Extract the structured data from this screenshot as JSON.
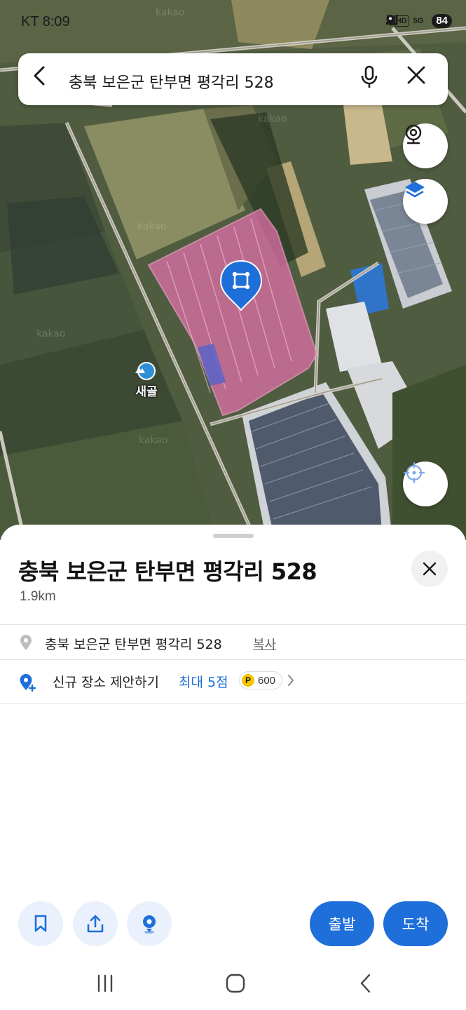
{
  "status_bar": {
    "carrier_time": "KT 8:09",
    "hd": "HD",
    "network": "5G",
    "battery": "84"
  },
  "search": {
    "query": "충북 보은군 탄부면 평각리 528",
    "back_icon": "chevron-left-icon",
    "mic_icon": "microphone-icon",
    "close_icon": "close-icon"
  },
  "map": {
    "watermark": "kakao",
    "place_label": "새골",
    "parcel_color": "#e070a8",
    "pin_color": "#1e6fd9",
    "buttons": [
      "roadview-icon",
      "layers-icon",
      "current-location-icon"
    ]
  },
  "sheet": {
    "title": "충북 보은군 탄부면 평각리 528",
    "distance": "1.9km",
    "address": "충북 보은군 탄부면 평각리 528",
    "copy_label": "복사",
    "suggest_label": "신규 장소 제안하기",
    "suggest_max": "최대 5점",
    "points_icon": "P",
    "points_value": "600"
  },
  "actions": {
    "start_label": "출발",
    "arrive_label": "도착",
    "icons": [
      "bookmark-icon",
      "share-icon",
      "pin-icon"
    ]
  },
  "colors": {
    "accent": "#1e6fd9",
    "accent_light": "#eaf1fc"
  }
}
